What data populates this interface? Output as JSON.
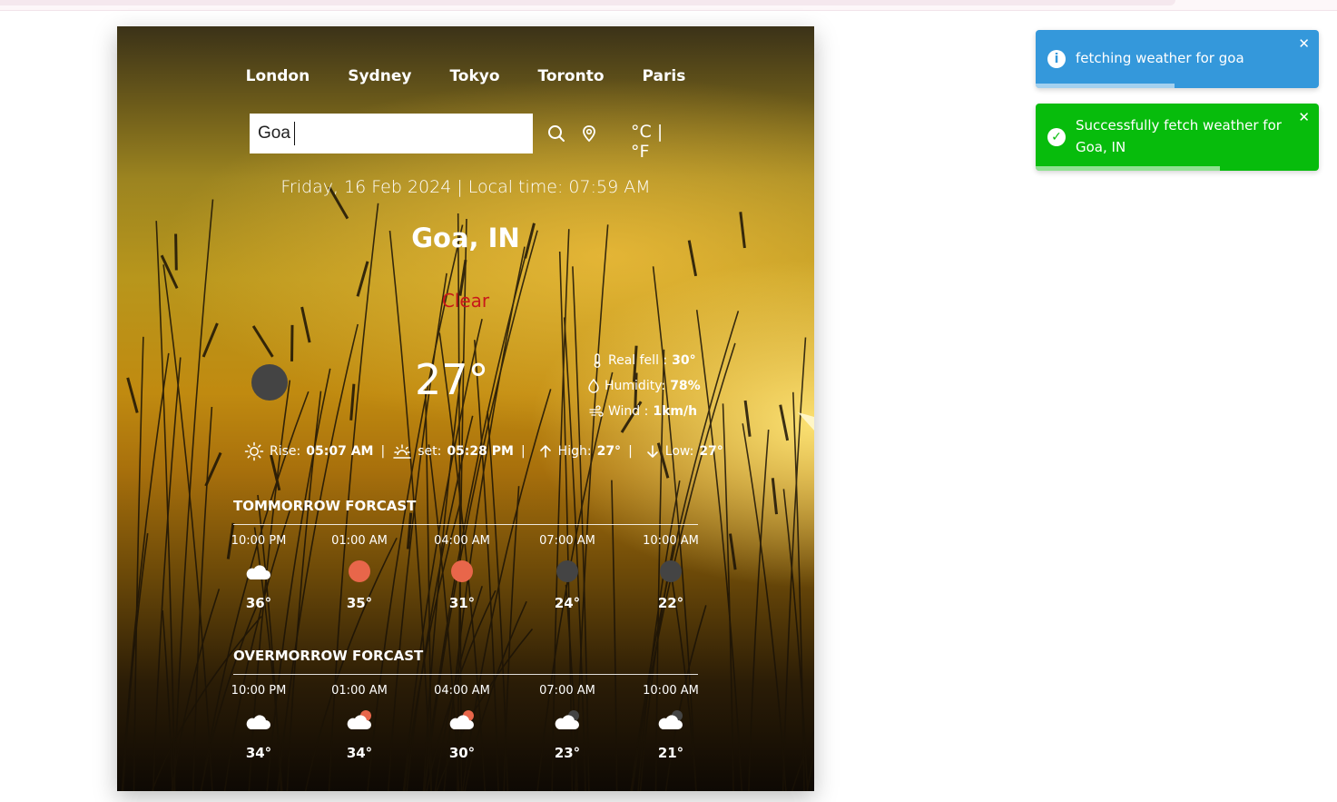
{
  "nav": {
    "cities": [
      "London",
      "Sydney",
      "Tokyo",
      "Toronto",
      "Paris"
    ]
  },
  "search": {
    "value": "Goa",
    "placeholder": ""
  },
  "units": {
    "celsius": "°C",
    "separator": "|",
    "fahrenheit": "°F"
  },
  "datetime": "Friday, 16 Feb 2024 | Local time: 07:59 AM",
  "location": "Goa, IN",
  "condition": "Clear",
  "current": {
    "temp": "27°",
    "real_feel_label": "Real fell :",
    "real_feel": "30°",
    "humidity_label": "Humidity:",
    "humidity": "78%",
    "wind_label": "Wind :",
    "wind": "1km/h"
  },
  "sun": {
    "rise_label": "Rise:",
    "rise": "05:07 AM",
    "set_label": "set:",
    "set": "05:28 PM",
    "high_label": "High:",
    "high": "27°",
    "low_label": "Low:",
    "low": "27°",
    "sep": "|"
  },
  "forecasts": [
    {
      "title": "TOMMORROW FORCAST",
      "items": [
        {
          "time": "10:00 PM",
          "icon": "cloud",
          "temp": "36°"
        },
        {
          "time": "01:00 AM",
          "icon": "sun",
          "temp": "35°"
        },
        {
          "time": "04:00 AM",
          "icon": "sun",
          "temp": "31°"
        },
        {
          "time": "07:00 AM",
          "icon": "moon",
          "temp": "24°"
        },
        {
          "time": "10:00 AM",
          "icon": "moon",
          "temp": "22°"
        }
      ]
    },
    {
      "title": "OVERMORROW FORCAST",
      "items": [
        {
          "time": "10:00 PM",
          "icon": "cloud",
          "temp": "34°"
        },
        {
          "time": "01:00 AM",
          "icon": "cloud-sun",
          "temp": "34°"
        },
        {
          "time": "04:00 AM",
          "icon": "cloud-sun",
          "temp": "30°"
        },
        {
          "time": "07:00 AM",
          "icon": "cloud-moon",
          "temp": "23°"
        },
        {
          "time": "10:00 AM",
          "icon": "cloud-moon",
          "temp": "21°"
        }
      ]
    }
  ],
  "toasts": [
    {
      "type": "info",
      "message": "fetching weather for goa",
      "color": "#3498db",
      "progress": 0.49,
      "close": "✕"
    },
    {
      "type": "success",
      "message": "Successfully fetch weather for Goa, IN",
      "color": "#07bc0c",
      "progress": 0.65,
      "close": "✕"
    }
  ],
  "colors": {
    "sun": "#e8664a",
    "moon": "#444444",
    "condition": "#c8181a"
  }
}
